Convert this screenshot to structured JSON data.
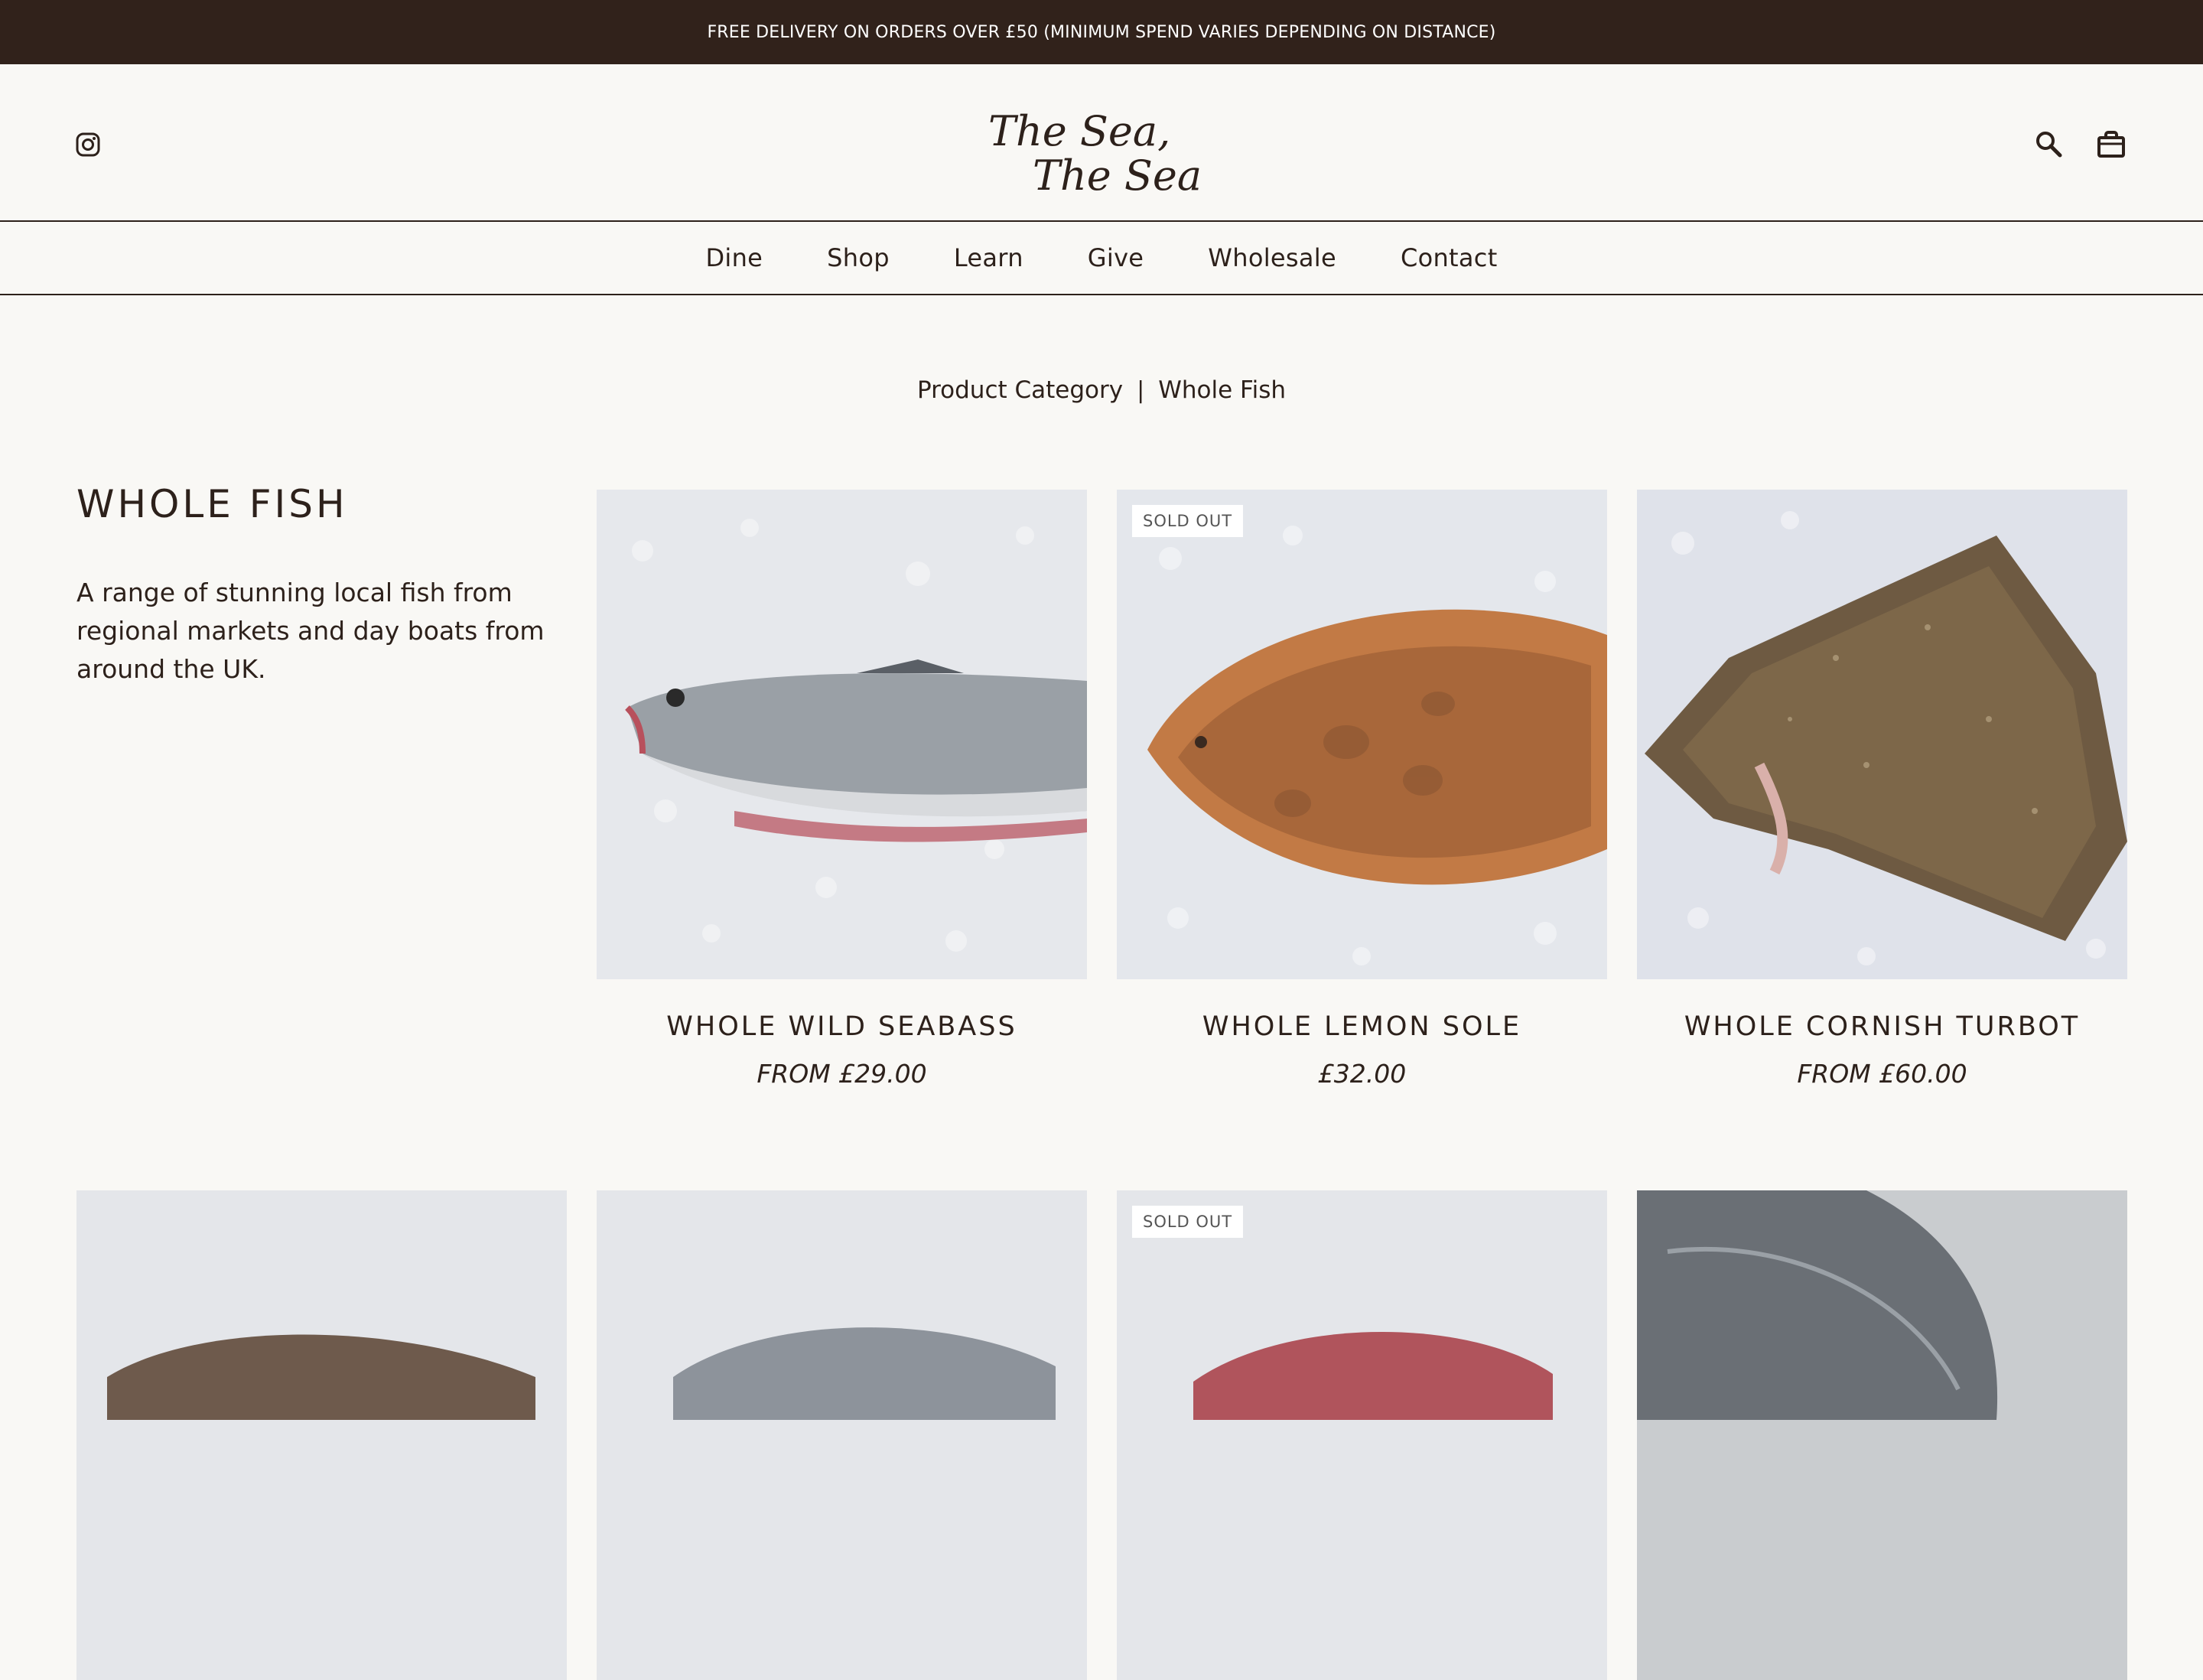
{
  "announcement": "FREE DELIVERY ON ORDERS OVER £50  (MINIMUM SPEND VARIES DEPENDING ON DISTANCE)",
  "header": {
    "logo_line1": "The Sea,",
    "logo_line2": "The Sea",
    "icons": [
      "instagram-icon",
      "search-icon",
      "bag-icon"
    ]
  },
  "nav": [
    "Dine",
    "Shop",
    "Learn",
    "Give",
    "Wholesale",
    "Contact"
  ],
  "breadcrumb": {
    "first": "Product Category",
    "separator": "|",
    "current": "Whole Fish"
  },
  "category": {
    "title": "WHOLE FISH",
    "description": "A range of stunning local fish from regional markets and day boats from around the UK."
  },
  "products": [
    {
      "name": "WHOLE WILD SEABASS",
      "price": "FROM £29.00",
      "badge": ""
    },
    {
      "name": "WHOLE LEMON SOLE",
      "price": "£32.00",
      "badge": "SOLD OUT"
    },
    {
      "name": "WHOLE CORNISH TURBOT",
      "price": "FROM £60.00",
      "badge": ""
    },
    {
      "name": "",
      "price": "",
      "badge": ""
    },
    {
      "name": "",
      "price": "",
      "badge": ""
    },
    {
      "name": "",
      "price": "",
      "badge": "SOLD OUT"
    },
    {
      "name": "",
      "price": "",
      "badge": ""
    }
  ],
  "colors": {
    "announce_bg": "#31221b",
    "text": "#2d211b",
    "page_bg": "#f9f8f5"
  }
}
